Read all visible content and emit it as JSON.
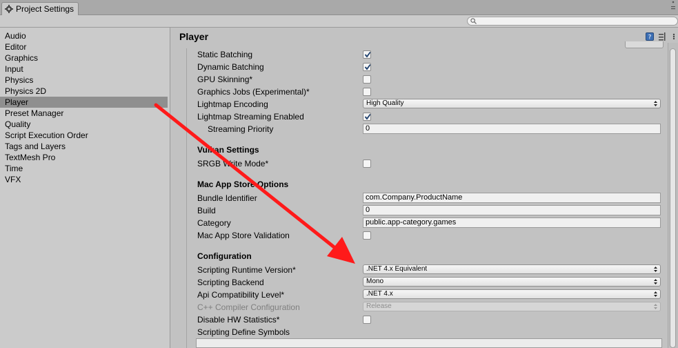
{
  "window": {
    "tab_title": "Project Settings"
  },
  "search": {
    "placeholder": ""
  },
  "sidebar": {
    "items": [
      {
        "label": "Audio",
        "selected": false
      },
      {
        "label": "Editor",
        "selected": false
      },
      {
        "label": "Graphics",
        "selected": false
      },
      {
        "label": "Input",
        "selected": false
      },
      {
        "label": "Physics",
        "selected": false
      },
      {
        "label": "Physics 2D",
        "selected": false
      },
      {
        "label": "Player",
        "selected": true
      },
      {
        "label": "Preset Manager",
        "selected": false
      },
      {
        "label": "Quality",
        "selected": false
      },
      {
        "label": "Script Execution Order",
        "selected": false
      },
      {
        "label": "Tags and Layers",
        "selected": false
      },
      {
        "label": "TextMesh Pro",
        "selected": false
      },
      {
        "label": "Time",
        "selected": false
      },
      {
        "label": "VFX",
        "selected": false
      }
    ]
  },
  "main": {
    "title": "Player",
    "rows": {
      "static_batching": {
        "label": "Static Batching",
        "checked": true
      },
      "dynamic_batching": {
        "label": "Dynamic Batching",
        "checked": true
      },
      "gpu_skinning": {
        "label": "GPU Skinning*",
        "checked": false
      },
      "graphics_jobs": {
        "label": "Graphics Jobs (Experimental)*",
        "checked": false
      },
      "lightmap_encoding": {
        "label": "Lightmap Encoding",
        "value": "High Quality"
      },
      "lightmap_streaming": {
        "label": "Lightmap Streaming Enabled",
        "checked": true
      },
      "streaming_priority": {
        "label": "Streaming Priority",
        "value": "0"
      },
      "srgb_write_mode": {
        "label": "SRGB Write Mode*",
        "checked": false
      },
      "bundle_identifier": {
        "label": "Bundle Identifier",
        "value": "com.Company.ProductName"
      },
      "build": {
        "label": "Build",
        "value": "0"
      },
      "category": {
        "label": "Category",
        "value": "public.app-category.games"
      },
      "mac_app_store_validation": {
        "label": "Mac App Store Validation",
        "checked": false
      },
      "scripting_runtime_version": {
        "label": "Scripting Runtime Version*",
        "value": ".NET 4.x Equivalent"
      },
      "scripting_backend": {
        "label": "Scripting Backend",
        "value": "Mono"
      },
      "api_compatibility_level": {
        "label": "Api Compatibility Level*",
        "value": ".NET 4.x"
      },
      "cpp_compiler_configuration": {
        "label": "C++ Compiler Configuration",
        "value": "Release",
        "disabled": true
      },
      "disable_hw_statistics": {
        "label": "Disable HW Statistics*",
        "checked": false
      },
      "scripting_define_symbols": {
        "label": "Scripting Define Symbols",
        "value": ""
      }
    },
    "sections": {
      "vulkan": "Vulkan Settings",
      "mac_app_store": "Mac App Store Options",
      "configuration": "Configuration"
    }
  },
  "colors": {
    "annotation_arrow": "#ff1a1a",
    "selected_item_bg": "#8f8f8f",
    "panel_bg": "#c2c2c2"
  },
  "icons": [
    "gear-icon",
    "menu-dots-icon",
    "search-icon",
    "help-icon",
    "presets-icon",
    "more-icon",
    "checkmark-icon",
    "dropdown-arrows-icon",
    "red-annotation-arrow"
  ]
}
